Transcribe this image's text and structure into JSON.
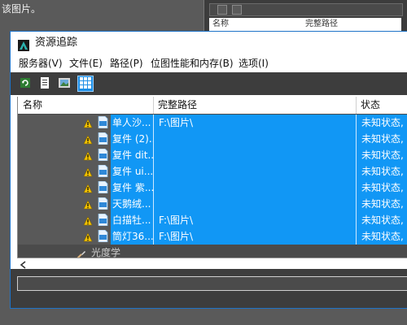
{
  "background": {
    "top_text": "该图片。",
    "window_header": {
      "col1": "名称",
      "col2": "完整路径"
    }
  },
  "dialog": {
    "title": "资源追踪",
    "menu": [
      "服务器(V)",
      "文件(E)",
      "路径(P)",
      "位图性能和内存(B)",
      "选项(I)"
    ],
    "toolbar": [
      {
        "icon": "refresh-icon",
        "active": false
      },
      {
        "icon": "document-list-icon",
        "active": false
      },
      {
        "icon": "image-thumbnail-icon",
        "active": false
      },
      {
        "icon": "grid-view-icon",
        "active": true
      }
    ],
    "table": {
      "headers": {
        "name": "名称",
        "path": "完整路径",
        "status": "状态"
      },
      "rows": [
        {
          "name": "单人沙...",
          "path": "F:\\图片\\",
          "status": "未知状态, ..."
        },
        {
          "name": "复件 (2)...",
          "path": "",
          "status": "未知状态, ..."
        },
        {
          "name": "复件 dit...",
          "path": "",
          "status": "未知状态, ..."
        },
        {
          "name": "复件 ui...",
          "path": "",
          "status": "未知状态, ..."
        },
        {
          "name": "复件 紫...",
          "path": "",
          "status": "未知状态, ..."
        },
        {
          "name": "天鹅绒...",
          "path": "",
          "status": "未知状态, ..."
        },
        {
          "name": "白描牡...",
          "path": "F:\\图片\\",
          "status": "未知状态, ..."
        },
        {
          "name": "筒灯36...",
          "path": "F:\\图片\\",
          "status": "未知状态, ..."
        }
      ],
      "group_row": {
        "label": "光度学"
      }
    },
    "colors": {
      "selection": "#1197f5",
      "dark_bg": "#3d3d3d",
      "warning": "#f2c200"
    }
  }
}
